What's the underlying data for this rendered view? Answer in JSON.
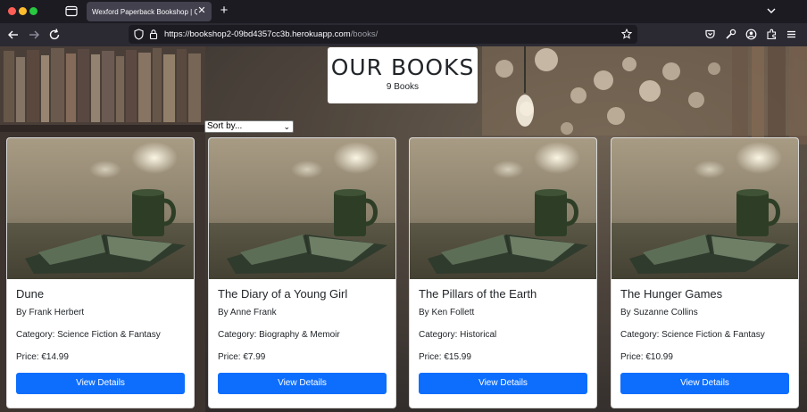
{
  "browser": {
    "tab_title": "Wexford Paperback Bookshop | Quality",
    "tab_close": "✕",
    "new_tab": "+",
    "url_main": "https://bookshop2-09bd4357cc3b.herokuapp.com",
    "url_path": "/books/"
  },
  "page": {
    "heading": "OUR BOOKS",
    "book_count": "9 Books",
    "sort_label": "Sort by...",
    "sort_chevron": "⌄"
  },
  "books": [
    {
      "title": "Dune",
      "author": "By Frank Herbert",
      "category": "Category: Science Fiction & Fantasy",
      "price": "Price: €14.99",
      "button": "View Details"
    },
    {
      "title": "The Diary of a Young Girl",
      "author": "By Anne Frank",
      "category": "Category: Biography & Memoir",
      "price": "Price: €7.99",
      "button": "View Details"
    },
    {
      "title": "The Pillars of the Earth",
      "author": "By Ken Follett",
      "category": "Category: Historical",
      "price": "Price: €15.99",
      "button": "View Details"
    },
    {
      "title": "The Hunger Games",
      "author": "By Suzanne Collins",
      "category": "Category: Science Fiction & Fantasy",
      "price": "Price: €10.99",
      "button": "View Details"
    }
  ],
  "colors": {
    "button_primary": "#0d6efd",
    "chrome_dark": "#1c1b22",
    "chrome_nav": "#2b2a33"
  }
}
